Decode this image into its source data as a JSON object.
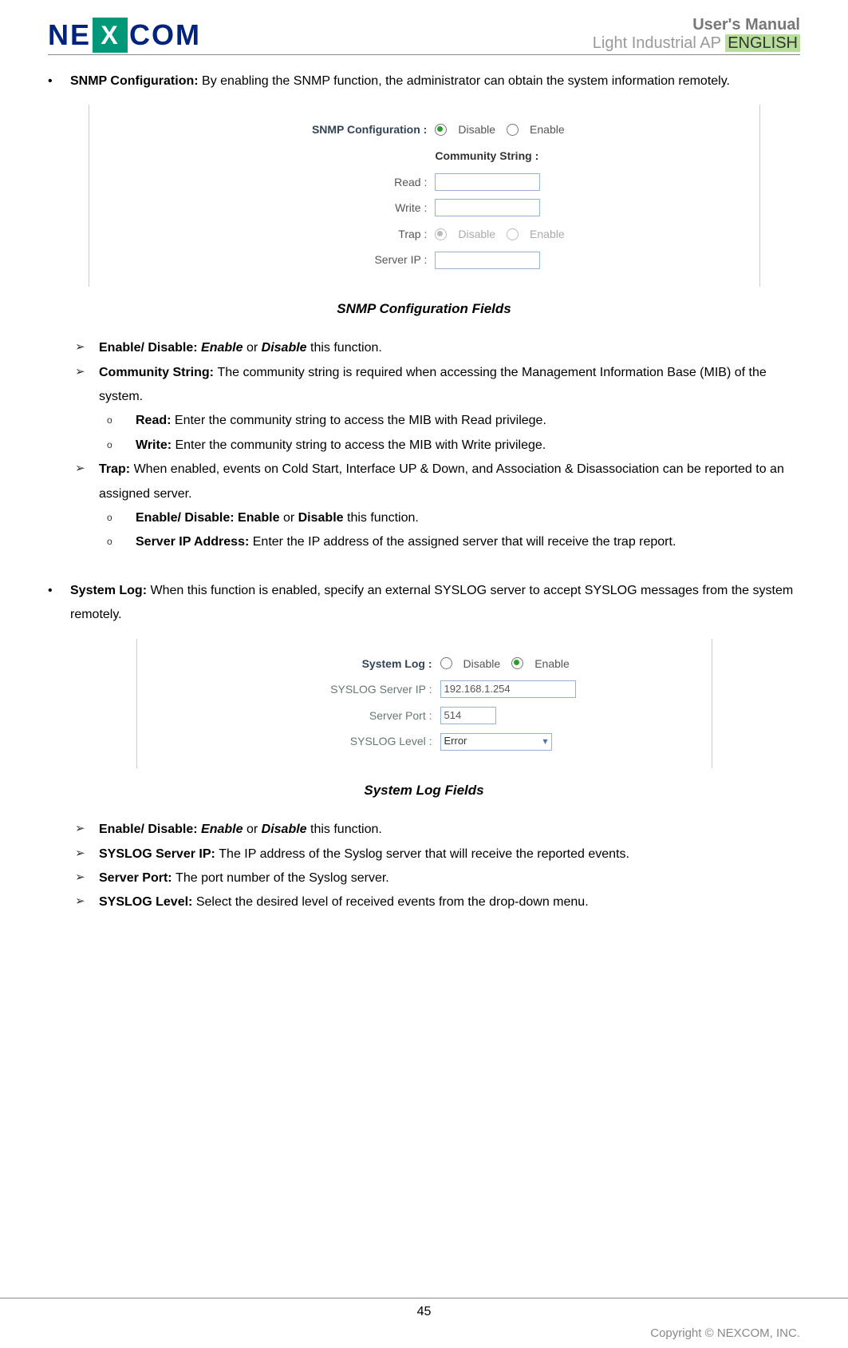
{
  "header": {
    "logo_ne": "NE",
    "logo_x": "X",
    "logo_com": "COM",
    "title": "User's Manual",
    "subtitle_a": "Light Industrial AP",
    "subtitle_b": "ENGLISH"
  },
  "snmp": {
    "head_label": "SNMP Configuration:",
    "head_text": " By enabling the SNMP function, the administrator can obtain the system information remotely.",
    "fig": {
      "title": "SNMP Configuration :",
      "disable": "Disable",
      "enable": "Enable",
      "community": "Community String :",
      "read": "Read :",
      "write": "Write :",
      "trap": "Trap :",
      "serverip": "Server IP :"
    },
    "caption": "SNMP Configuration Fields",
    "items": {
      "enable_label": "Enable/ Disable: ",
      "enable_e": "Enable",
      "enable_mid": " or ",
      "enable_d": "Disable",
      "enable_tail": " this function.",
      "comm_label": "Community String: ",
      "comm_text": "The community string is required when accessing the Management Information Base (MIB) of the system.",
      "read_label": "Read: ",
      "read_text": "Enter the community string to access the MIB with Read privilege.",
      "write_label": "Write: ",
      "write_text": "Enter the community string to access the MIB with Write privilege.",
      "trap_label": "Trap: ",
      "trap_text": "When enabled, events on Cold Start, Interface UP & Down, and Association & Disassociation can be reported to an assigned server.",
      "trap_en_label": "Enable/ Disable: Enable",
      "trap_en_mid": " or ",
      "trap_en_d": "Disable",
      "trap_en_tail": " this function.",
      "trap_ip_label": "Server IP Address: ",
      "trap_ip_text": "Enter the IP address of the assigned server that will receive the trap report."
    }
  },
  "syslog": {
    "head_label": "System Log: ",
    "head_text": "When this function is enabled, specify an external SYSLOG server to accept SYSLOG messages from the system remotely.",
    "fig": {
      "title": "System Log :",
      "disable": "Disable",
      "enable": "Enable",
      "ip_label": "SYSLOG Server IP :",
      "ip_value": "192.168.1.254",
      "port_label": "Server Port :",
      "port_value": "514",
      "level_label": "SYSLOG Level :",
      "level_value": "Error"
    },
    "caption": "System Log Fields",
    "items": {
      "enable_label": "Enable/ Disable: ",
      "enable_e": "Enable",
      "enable_mid": " or ",
      "enable_d": "Disable",
      "enable_tail": " this function.",
      "ip_label": "SYSLOG Server IP: ",
      "ip_text": "The IP address of the Syslog server that will receive the reported events.",
      "port_label": "Server Port:  ",
      "port_text": "The port number of the Syslog server.",
      "level_label": "SYSLOG Level: ",
      "level_text": "Select the desired level of received events from the drop-down menu."
    }
  },
  "footer": {
    "page": "45",
    "copyright": "Copyright © NEXCOM, INC."
  }
}
